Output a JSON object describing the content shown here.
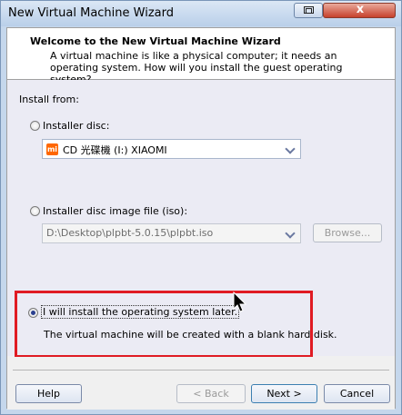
{
  "window": {
    "title": "New Virtual Machine Wizard",
    "close_glyph": "x"
  },
  "header": {
    "title": "Welcome to the New Virtual Machine Wizard",
    "description": "A virtual machine is like a physical computer; it needs an operating system. How will you install the guest operating system?"
  },
  "install": {
    "label": "Install from:",
    "disc": {
      "label": "Installer disc:",
      "selected": false,
      "drive_logo": "mi",
      "drive_value": "CD 光碟機 (I:) XIAOMI"
    },
    "iso": {
      "label": "Installer disc image file (iso):",
      "selected": false,
      "path_value": "D:\\Desktop\\plpbt-5.0.15\\plpbt.iso",
      "browse_label": "Browse..."
    },
    "later": {
      "label": "I will install the operating system later.",
      "selected": true,
      "note": "The virtual machine will be created with a blank hard disk."
    }
  },
  "footer": {
    "help_label": "Help",
    "back_label": "< Back",
    "next_label": "Next >",
    "cancel_label": "Cancel"
  },
  "colors": {
    "highlight": "#e01b23",
    "brand_orange": "#ff6700"
  }
}
